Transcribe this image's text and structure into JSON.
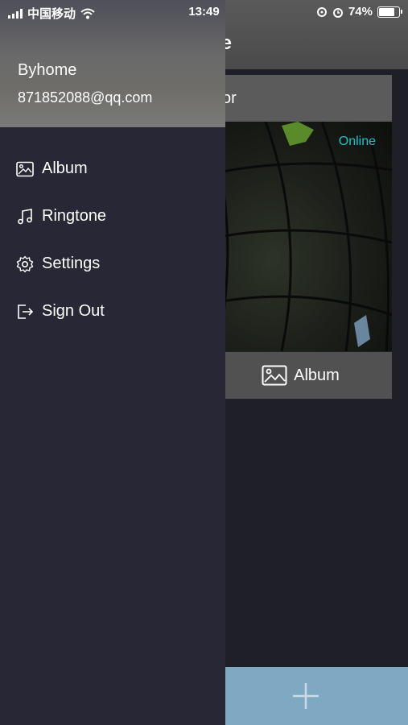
{
  "status_bar": {
    "carrier": "中国移动",
    "time": "13:49",
    "battery": "74%"
  },
  "background": {
    "title_fragment": "ne",
    "device_name_fragment": "or",
    "camera_status": "Online",
    "album_label": "Album",
    "add_icon": "plus-icon"
  },
  "drawer": {
    "user_name": "Byhome",
    "user_email": "871852088@qq.com",
    "menu": [
      {
        "label": "Album",
        "icon": "image-icon"
      },
      {
        "label": "Ringtone",
        "icon": "music-note-icon"
      },
      {
        "label": "Settings",
        "icon": "gear-icon"
      },
      {
        "label": "Sign Out",
        "icon": "sign-out-icon"
      }
    ]
  },
  "colors": {
    "drawer_bg": "#272735",
    "online": "#22c1c7",
    "add_bar": "#7fa8c3"
  }
}
